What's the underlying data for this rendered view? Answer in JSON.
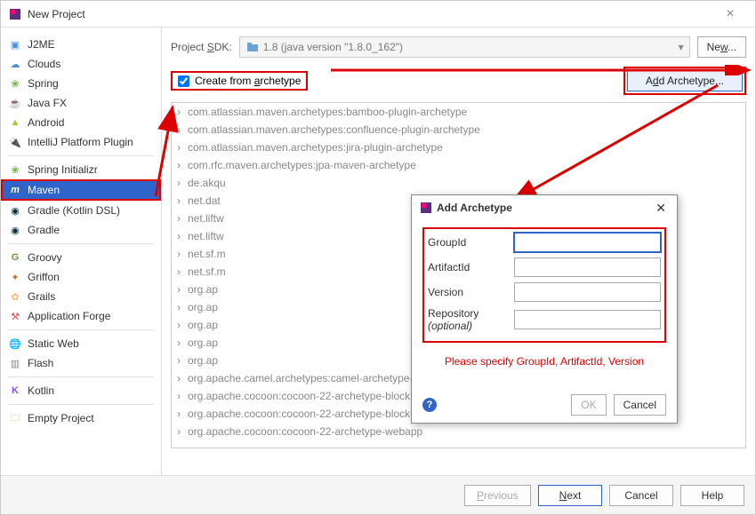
{
  "window": {
    "title": "New Project"
  },
  "sidebar": {
    "items": [
      {
        "label": "J2ME",
        "icon": "📱"
      },
      {
        "label": "Clouds",
        "icon": "☁"
      },
      {
        "label": "Spring",
        "icon": "🍃"
      },
      {
        "label": "Java FX",
        "icon": "☕"
      },
      {
        "label": "Android",
        "icon": "🤖"
      },
      {
        "label": "IntelliJ Platform Plugin",
        "icon": "🔌"
      }
    ],
    "items2": [
      {
        "label": "Spring Initializr",
        "icon": "🍃"
      },
      {
        "label": "Maven",
        "icon": "m",
        "selected": true
      },
      {
        "label": "Gradle (Kotlin DSL)",
        "icon": "◉"
      },
      {
        "label": "Gradle",
        "icon": "◉"
      }
    ],
    "items3": [
      {
        "label": "Groovy",
        "icon": "G"
      },
      {
        "label": "Griffon",
        "icon": "🦅"
      },
      {
        "label": "Grails",
        "icon": "🧩"
      },
      {
        "label": "Application Forge",
        "icon": "🔨"
      }
    ],
    "items4": [
      {
        "label": "Static Web",
        "icon": "🌐"
      },
      {
        "label": "Flash",
        "icon": "📄"
      }
    ],
    "items5": [
      {
        "label": "Kotlin",
        "icon": "K"
      }
    ],
    "items6": [
      {
        "label": "Empty Project",
        "icon": "📁"
      }
    ]
  },
  "sdk": {
    "label": "Project SDK:",
    "value": "1.8 (java version \"1.8.0_162\")",
    "new_btn": "New..."
  },
  "archetype": {
    "checkbox_label": "Create from archetype",
    "add_btn": "Add Archetype...",
    "items": [
      "com.atlassian.maven.archetypes:bamboo-plugin-archetype",
      "com.atlassian.maven.archetypes:confluence-plugin-archetype",
      "com.atlassian.maven.archetypes:jira-plugin-archetype",
      "com.rfc.maven.archetypes:jpa-maven-archetype",
      "de.akqu",
      "net.dat",
      "net.liftw",
      "net.liftw",
      "net.sf.m",
      "net.sf.m",
      "org.ap",
      "org.ap",
      "org.ap",
      "org.ap",
      "org.ap",
      "org.apache.camel.archetypes:camel-archetype-war",
      "org.apache.cocoon:cocoon-22-archetype-block",
      "org.apache.cocoon:cocoon-22-archetype-block-plain",
      "org.apache.cocoon:cocoon-22-archetype-webapp"
    ]
  },
  "dialog": {
    "title": "Add Archetype",
    "fields": {
      "groupid_label": "GroupId",
      "artifactid_label": "ArtifactId",
      "version_label": "Version",
      "repository_label": "Repository (optional)"
    },
    "error": "Please specify GroupId, ArtifactId, Version",
    "ok": "OK",
    "cancel": "Cancel"
  },
  "footer": {
    "previous": "Previous",
    "next": "Next",
    "cancel": "Cancel",
    "help": "Help"
  }
}
